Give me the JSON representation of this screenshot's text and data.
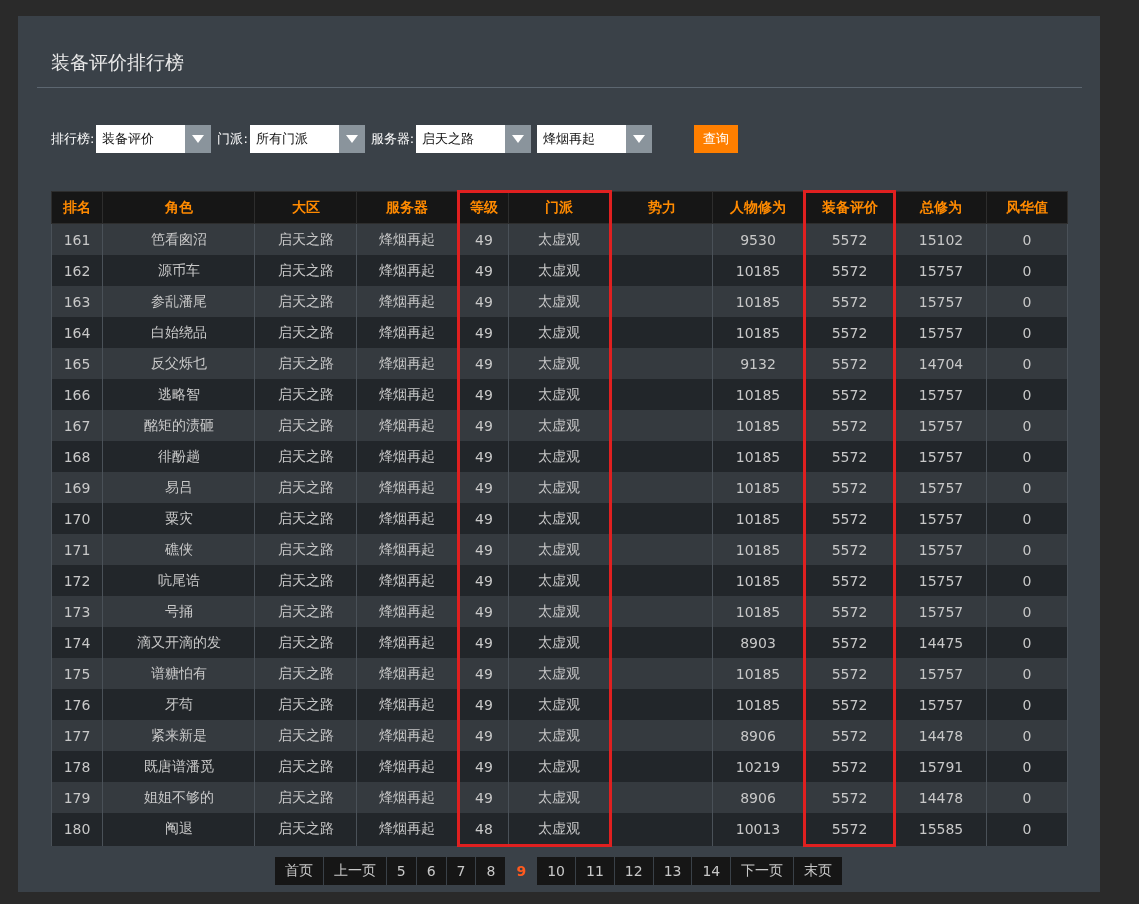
{
  "panel": {
    "title": "装备评价排行榜"
  },
  "filters": [
    {
      "label": "排行榜:",
      "value": "装备评价"
    },
    {
      "label": "门派:",
      "value": "所有门派"
    },
    {
      "label": "服务器:",
      "value": "启天之路"
    },
    {
      "value": "烽烟再起"
    }
  ],
  "query_button": "查询",
  "table": {
    "columns": [
      {
        "label": "排名",
        "highlighted": false
      },
      {
        "label": "角色",
        "highlighted": false
      },
      {
        "label": "大区",
        "highlighted": false
      },
      {
        "label": "服务器",
        "highlighted": false
      },
      {
        "label": "等级",
        "highlighted": true
      },
      {
        "label": "门派",
        "highlighted": true
      },
      {
        "label": "势力",
        "highlighted": false
      },
      {
        "label": "人物修为",
        "highlighted": false
      },
      {
        "label": "装备评价",
        "highlighted": true
      },
      {
        "label": "总修为",
        "highlighted": false
      },
      {
        "label": "风华值",
        "highlighted": false
      }
    ],
    "rows": [
      {
        "rank": "161",
        "name": "笆看囪沼",
        "region": "启天之路",
        "server": "烽烟再起",
        "level": "49",
        "sect": "太虚观",
        "cultivation": "9530",
        "gear_score": "5572",
        "total": "15102",
        "fenghua": "0"
      },
      {
        "rank": "162",
        "name": "源币车",
        "region": "启天之路",
        "server": "烽烟再起",
        "level": "49",
        "sect": "太虚观",
        "cultivation": "10185",
        "gear_score": "5572",
        "total": "15757",
        "fenghua": "0"
      },
      {
        "rank": "163",
        "name": "参乱潘尾",
        "region": "启天之路",
        "server": "烽烟再起",
        "level": "49",
        "sect": "太虚观",
        "cultivation": "10185",
        "gear_score": "5572",
        "total": "15757",
        "fenghua": "0"
      },
      {
        "rank": "164",
        "name": "白始绕品",
        "region": "启天之路",
        "server": "烽烟再起",
        "level": "49",
        "sect": "太虚观",
        "cultivation": "10185",
        "gear_score": "5572",
        "total": "15757",
        "fenghua": "0"
      },
      {
        "rank": "165",
        "name": "反父烁乜",
        "region": "启天之路",
        "server": "烽烟再起",
        "level": "49",
        "sect": "太虚观",
        "cultivation": "9132",
        "gear_score": "5572",
        "total": "14704",
        "fenghua": "0"
      },
      {
        "rank": "166",
        "name": "逃略智",
        "region": "启天之路",
        "server": "烽烟再起",
        "level": "49",
        "sect": "太虚观",
        "cultivation": "10185",
        "gear_score": "5572",
        "total": "15757",
        "fenghua": "0"
      },
      {
        "rank": "167",
        "name": "酩矩的渍砸",
        "region": "启天之路",
        "server": "烽烟再起",
        "level": "49",
        "sect": "太虚观",
        "cultivation": "10185",
        "gear_score": "5572",
        "total": "15757",
        "fenghua": "0"
      },
      {
        "rank": "168",
        "name": "徘酚趟",
        "region": "启天之路",
        "server": "烽烟再起",
        "level": "49",
        "sect": "太虚观",
        "cultivation": "10185",
        "gear_score": "5572",
        "total": "15757",
        "fenghua": "0"
      },
      {
        "rank": "169",
        "name": "易吕",
        "region": "启天之路",
        "server": "烽烟再起",
        "level": "49",
        "sect": "太虚观",
        "cultivation": "10185",
        "gear_score": "5572",
        "total": "15757",
        "fenghua": "0"
      },
      {
        "rank": "170",
        "name": "粟灾",
        "region": "启天之路",
        "server": "烽烟再起",
        "level": "49",
        "sect": "太虚观",
        "cultivation": "10185",
        "gear_score": "5572",
        "total": "15757",
        "fenghua": "0"
      },
      {
        "rank": "171",
        "name": "礁侠",
        "region": "启天之路",
        "server": "烽烟再起",
        "level": "49",
        "sect": "太虚观",
        "cultivation": "10185",
        "gear_score": "5572",
        "total": "15757",
        "fenghua": "0"
      },
      {
        "rank": "172",
        "name": "吭尾诰",
        "region": "启天之路",
        "server": "烽烟再起",
        "level": "49",
        "sect": "太虚观",
        "cultivation": "10185",
        "gear_score": "5572",
        "total": "15757",
        "fenghua": "0"
      },
      {
        "rank": "173",
        "name": "号捅",
        "region": "启天之路",
        "server": "烽烟再起",
        "level": "49",
        "sect": "太虚观",
        "cultivation": "10185",
        "gear_score": "5572",
        "total": "15757",
        "fenghua": "0"
      },
      {
        "rank": "174",
        "name": "滴又开滴的发",
        "region": "启天之路",
        "server": "烽烟再起",
        "level": "49",
        "sect": "太虚观",
        "cultivation": "8903",
        "gear_score": "5572",
        "total": "14475",
        "fenghua": "0"
      },
      {
        "rank": "175",
        "name": "谱糖怕有",
        "region": "启天之路",
        "server": "烽烟再起",
        "level": "49",
        "sect": "太虚观",
        "cultivation": "10185",
        "gear_score": "5572",
        "total": "15757",
        "fenghua": "0"
      },
      {
        "rank": "176",
        "name": "牙苟",
        "region": "启天之路",
        "server": "烽烟再起",
        "level": "49",
        "sect": "太虚观",
        "cultivation": "10185",
        "gear_score": "5572",
        "total": "15757",
        "fenghua": "0"
      },
      {
        "rank": "177",
        "name": "紧来新是",
        "region": "启天之路",
        "server": "烽烟再起",
        "level": "49",
        "sect": "太虚观",
        "cultivation": "8906",
        "gear_score": "5572",
        "total": "14478",
        "fenghua": "0"
      },
      {
        "rank": "178",
        "name": "既唐谱潘觅",
        "region": "启天之路",
        "server": "烽烟再起",
        "level": "49",
        "sect": "太虚观",
        "cultivation": "10219",
        "gear_score": "5572",
        "total": "15791",
        "fenghua": "0"
      },
      {
        "rank": "179",
        "name": "姐姐不够的",
        "region": "启天之路",
        "server": "烽烟再起",
        "level": "49",
        "sect": "太虚观",
        "cultivation": "8906",
        "gear_score": "5572",
        "total": "14478",
        "fenghua": "0"
      },
      {
        "rank": "180",
        "name": "阄退",
        "region": "启天之路",
        "server": "烽烟再起",
        "level": "48",
        "sect": "太虚观",
        "cultivation": "10013",
        "gear_score": "5572",
        "total": "15585",
        "fenghua": "0"
      }
    ]
  },
  "pagination": [
    {
      "label": "首页",
      "selected": false
    },
    {
      "label": "上一页",
      "selected": false
    },
    {
      "label": "5",
      "selected": false
    },
    {
      "label": "6",
      "selected": false
    },
    {
      "label": "7",
      "selected": false
    },
    {
      "label": "8",
      "selected": false
    },
    {
      "label": "9",
      "selected": true
    },
    {
      "label": "10",
      "selected": false
    },
    {
      "label": "11",
      "selected": false
    },
    {
      "label": "12",
      "selected": false
    },
    {
      "label": "13",
      "selected": false
    },
    {
      "label": "14",
      "selected": false
    },
    {
      "label": "下一页",
      "selected": false
    },
    {
      "label": "末页",
      "selected": false
    }
  ]
}
